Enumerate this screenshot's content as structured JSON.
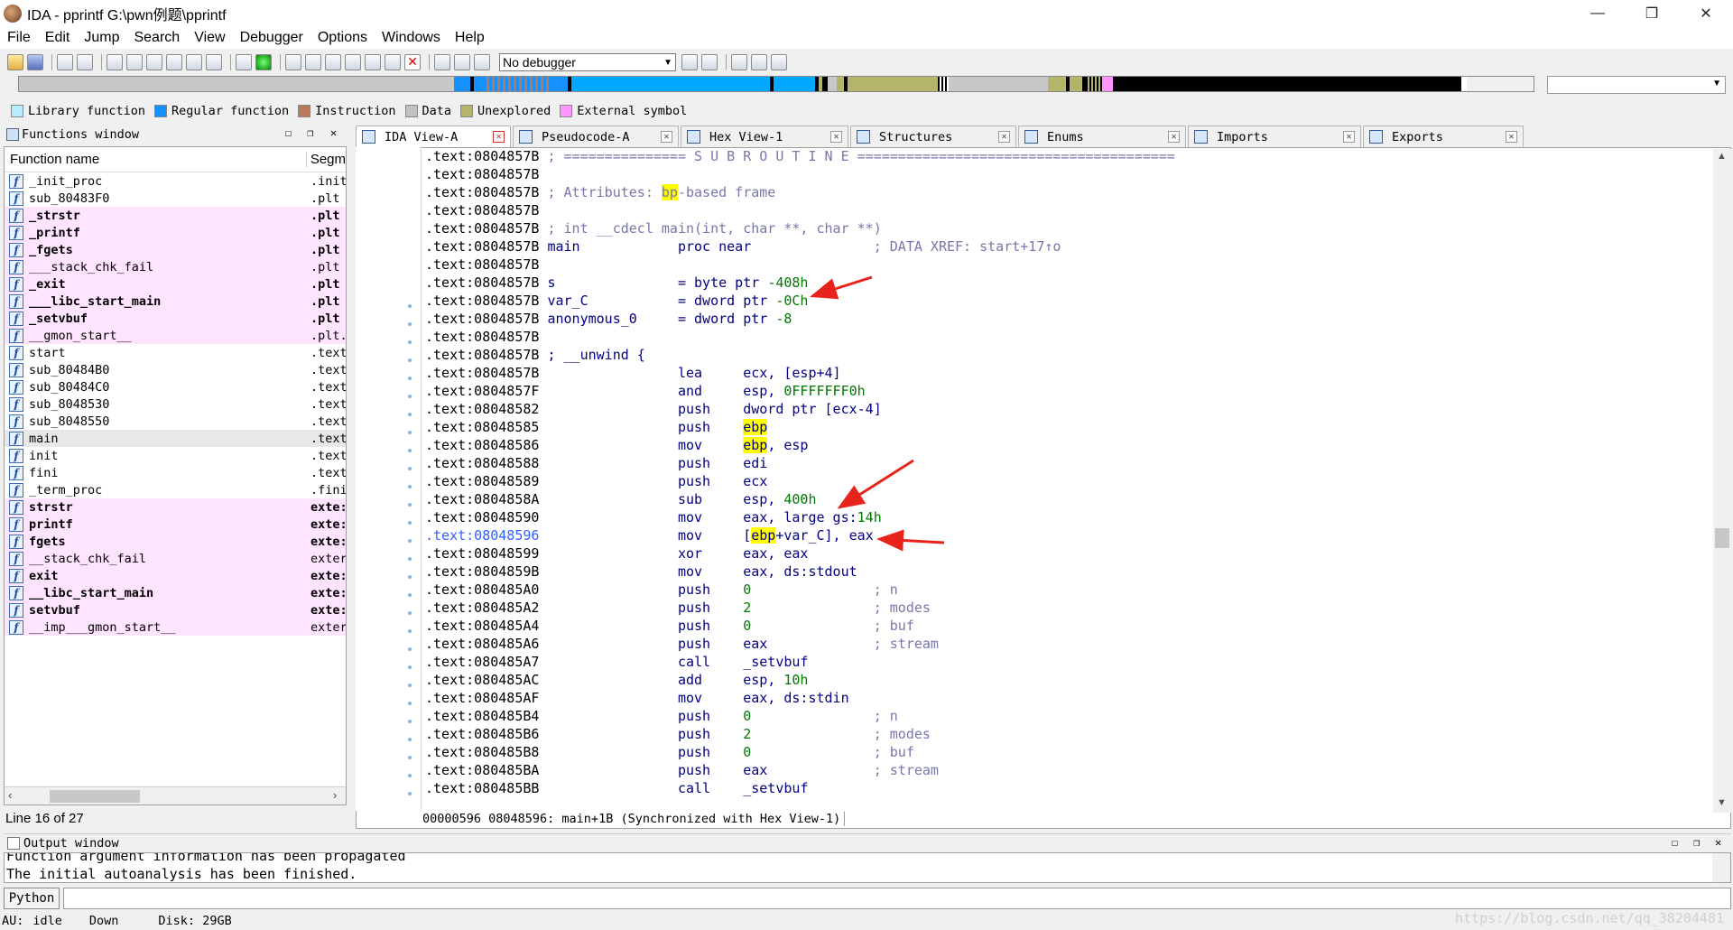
{
  "window": {
    "title": "IDA - pprintf G:\\pwn例题\\pprintf",
    "minimize": "—",
    "maximize": "❐",
    "close": "✕"
  },
  "menu": [
    "File",
    "Edit",
    "Jump",
    "Search",
    "View",
    "Debugger",
    "Options",
    "Windows",
    "Help"
  ],
  "toolbar": {
    "debugger_select": "No debugger"
  },
  "legend": [
    {
      "label": "Library function",
      "color": "#b8ecff"
    },
    {
      "label": "Regular function",
      "color": "#1591ff"
    },
    {
      "label": "Instruction",
      "color": "#b87a5c"
    },
    {
      "label": "Data",
      "color": "#c0c0c0"
    },
    {
      "label": "Unexplored",
      "color": "#b4b46a"
    },
    {
      "label": "External symbol",
      "color": "#ff96ff"
    }
  ],
  "functions_window": {
    "title": "Functions window",
    "col_name": "Function name",
    "col_segment": "Segm",
    "status": "Line 16 of 27",
    "rows": [
      {
        "name": "_init_proc",
        "seg": ".init",
        "style": ""
      },
      {
        "name": "sub_80483F0",
        "seg": ".plt",
        "style": ""
      },
      {
        "name": "_strstr",
        "seg": ".plt",
        "style": "lib bold"
      },
      {
        "name": "_printf",
        "seg": ".plt",
        "style": "lib bold"
      },
      {
        "name": "_fgets",
        "seg": ".plt",
        "style": "lib bold"
      },
      {
        "name": "___stack_chk_fail",
        "seg": ".plt",
        "style": "lib"
      },
      {
        "name": "_exit",
        "seg": ".plt",
        "style": "lib bold"
      },
      {
        "name": "___libc_start_main",
        "seg": ".plt",
        "style": "lib bold"
      },
      {
        "name": "_setvbuf",
        "seg": ".plt",
        "style": "lib bold"
      },
      {
        "name": "__gmon_start__",
        "seg": ".plt.",
        "style": "lib"
      },
      {
        "name": "start",
        "seg": ".text",
        "style": ""
      },
      {
        "name": "sub_80484B0",
        "seg": ".text",
        "style": ""
      },
      {
        "name": "sub_80484C0",
        "seg": ".text",
        "style": ""
      },
      {
        "name": "sub_8048530",
        "seg": ".text",
        "style": ""
      },
      {
        "name": "sub_8048550",
        "seg": ".text",
        "style": ""
      },
      {
        "name": "main",
        "seg": ".text",
        "style": "sel"
      },
      {
        "name": "init",
        "seg": ".text",
        "style": ""
      },
      {
        "name": "fini",
        "seg": ".text",
        "style": ""
      },
      {
        "name": "_term_proc",
        "seg": ".fini",
        "style": ""
      },
      {
        "name": "strstr",
        "seg": "exte:",
        "style": "lib bold"
      },
      {
        "name": "printf",
        "seg": "exte:",
        "style": "lib bold"
      },
      {
        "name": "fgets",
        "seg": "exte:",
        "style": "lib bold"
      },
      {
        "name": "__stack_chk_fail",
        "seg": "exter",
        "style": "lib"
      },
      {
        "name": "exit",
        "seg": "exte:",
        "style": "lib bold"
      },
      {
        "name": "__libc_start_main",
        "seg": "exte:",
        "style": "lib bold"
      },
      {
        "name": "setvbuf",
        "seg": "exte:",
        "style": "lib bold"
      },
      {
        "name": "__imp___gmon_start__",
        "seg": "exter",
        "style": "lib"
      }
    ]
  },
  "tabs": [
    {
      "label": "IDA View-A",
      "active": true
    },
    {
      "label": "Pseudocode-A",
      "active": false
    },
    {
      "label": "Hex View-1",
      "active": false
    },
    {
      "label": "Structures",
      "active": false
    },
    {
      "label": "Enums",
      "active": false
    },
    {
      "label": "Imports",
      "active": false
    },
    {
      "label": "Exports",
      "active": false
    }
  ],
  "ida_view": {
    "status": "00000596 08048596: main+1B (Synchronized with Hex View-1)",
    "lines": [
      {
        "addr": ".text:0804857B",
        "html": " <span class=\"cmt\">; =============== S U B R O U T I N E =======================================</span>"
      },
      {
        "addr": ".text:0804857B",
        "html": ""
      },
      {
        "addr": ".text:0804857B",
        "html": " <span class=\"cmt\">; Attributes: <span class=\"yel\">bp</span>-based frame</span>"
      },
      {
        "addr": ".text:0804857B",
        "html": ""
      },
      {
        "addr": ".text:0804857B",
        "html": " <span class=\"cmt\">; int __cdecl main(int, char **, char **)</span>"
      },
      {
        "addr": ".text:0804857B",
        "html": " main            proc near               <span class=\"cmt\">; DATA XREF: start+17↑o</span>"
      },
      {
        "addr": ".text:0804857B",
        "html": ""
      },
      {
        "addr": ".text:0804857B",
        "html": " s               = byte ptr <span class=\"grn\">-408h</span>"
      },
      {
        "addr": ".text:0804857B",
        "html": " var_C           = dword ptr <span class=\"grn\">-0Ch</span>"
      },
      {
        "addr": ".text:0804857B",
        "html": " anonymous_0     = dword ptr <span class=\"grn\">-8</span>"
      },
      {
        "addr": ".text:0804857B",
        "html": ""
      },
      {
        "addr": ".text:0804857B",
        "html": " ; __unwind {"
      },
      {
        "addr": ".text:0804857B",
        "html": "                 lea     ecx, [esp+4]"
      },
      {
        "addr": ".text:0804857F",
        "html": "                 and     esp, <span class=\"grn\">0FFFFFFF0h</span>"
      },
      {
        "addr": ".text:08048582",
        "html": "                 push    dword ptr [ecx-4]"
      },
      {
        "addr": ".text:08048585",
        "html": "                 push    <span class=\"yel\">ebp</span>"
      },
      {
        "addr": ".text:08048586",
        "html": "                 mov     <span class=\"yel\">ebp</span>, esp"
      },
      {
        "addr": ".text:08048588",
        "html": "                 push    edi"
      },
      {
        "addr": ".text:08048589",
        "html": "                 push    ecx"
      },
      {
        "addr": ".text:0804858A",
        "html": "                 sub     esp, <span class=\"grn\">400h</span>"
      },
      {
        "addr": ".text:08048590",
        "html": "                 mov     eax, large gs:<span class=\"grn\">14h</span>"
      },
      {
        "addr": ".text:08048596",
        "html": "                 mov     [<span class=\"yel\">ebp</span>+var_C], eax",
        "hl": true
      },
      {
        "addr": ".text:08048599",
        "html": "                 xor     eax, eax"
      },
      {
        "addr": ".text:0804859B",
        "html": "                 mov     eax, ds:stdout"
      },
      {
        "addr": ".text:080485A0",
        "html": "                 push    <span class=\"grn\">0</span>               <span class=\"cmt\">; n</span>"
      },
      {
        "addr": ".text:080485A2",
        "html": "                 push    <span class=\"grn\">2</span>               <span class=\"cmt\">; modes</span>"
      },
      {
        "addr": ".text:080485A4",
        "html": "                 push    <span class=\"grn\">0</span>               <span class=\"cmt\">; buf</span>"
      },
      {
        "addr": ".text:080485A6",
        "html": "                 push    eax             <span class=\"cmt\">; stream</span>"
      },
      {
        "addr": ".text:080485A7",
        "html": "                 call    _setvbuf"
      },
      {
        "addr": ".text:080485AC",
        "html": "                 add     esp, <span class=\"grn\">10h</span>"
      },
      {
        "addr": ".text:080485AF",
        "html": "                 mov     eax, ds:stdin"
      },
      {
        "addr": ".text:080485B4",
        "html": "                 push    <span class=\"grn\">0</span>               <span class=\"cmt\">; n</span>"
      },
      {
        "addr": ".text:080485B6",
        "html": "                 push    <span class=\"grn\">2</span>               <span class=\"cmt\">; modes</span>"
      },
      {
        "addr": ".text:080485B8",
        "html": "                 push    <span class=\"grn\">0</span>               <span class=\"cmt\">; buf</span>"
      },
      {
        "addr": ".text:080485BA",
        "html": "                 push    eax             <span class=\"cmt\">; stream</span>"
      },
      {
        "addr": ".text:080485BB",
        "html": "                 call    _setvbuf"
      }
    ]
  },
  "output_window": {
    "title": "Output window",
    "lines": [
      "Function argument information has been propagated",
      "The initial autoanalysis has been finished."
    ]
  },
  "python_button": "Python",
  "statusbar": {
    "au": "AU:",
    "state": "idle",
    "direction": "Down",
    "disk": "Disk: 29GB"
  },
  "watermark": "https://blog.csdn.net/qq_38204481"
}
